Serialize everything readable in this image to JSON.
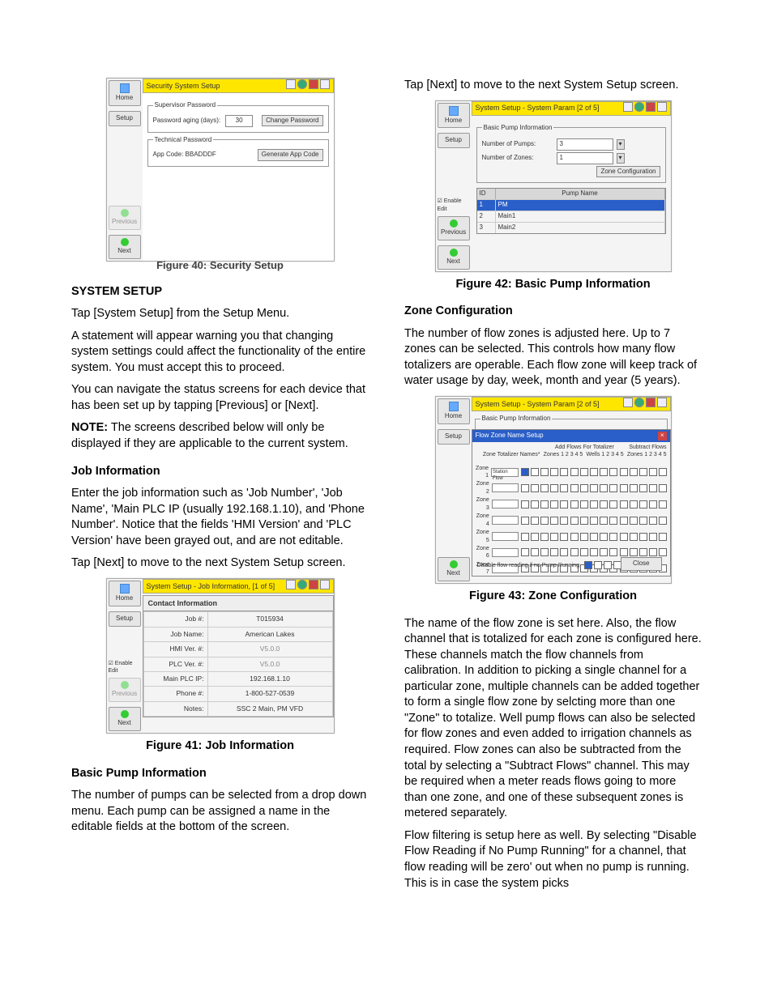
{
  "left": {
    "fig40": {
      "caption": "Figure 40: Security Setup",
      "title": "Security System Setup",
      "home": "Home",
      "setup": "Setup",
      "previous": "Previous",
      "next": "Next",
      "supLegend": "Supervisor Password",
      "pwAgingLabel": "Password aging (days):",
      "pwAgingVal": "30",
      "changePw": "Change Password",
      "techLegend": "Technical Password",
      "appCode": "App Code: BBADDDF",
      "genAppCode": "Generate App Code"
    },
    "h1": "SYSTEM SETUP",
    "p1": "Tap [System Setup] from the Setup Menu.",
    "p2": "A statement will appear warning you that changing system settings could affect the functionality of the entire system. You must accept this to proceed.",
    "p3": "You can navigate the status screens for each device that has been set up by tapping [Previous] or [Next].",
    "noteLabel": "NOTE:",
    "noteBody": " The screens described below will only be displayed if they are applicable to the current system.",
    "h2": "Job Information",
    "p4": "Enter the job information such as 'Job Number', 'Job Name', 'Main PLC IP (usually 192.168.1.10), and 'Phone Number'. Notice that the fields 'HMI Version' and 'PLC Version' have been grayed out, and are not editable.",
    "p5": "Tap [Next] to move to the next System Setup screen.",
    "fig41": {
      "caption": "Figure 41: Job Information",
      "title": "System Setup - Job Information, [1 of 5]",
      "ci": "Contact Information",
      "rows": [
        {
          "label": "Job #:",
          "value": "T015934"
        },
        {
          "label": "Job Name:",
          "value": "American Lakes"
        },
        {
          "label": "HMI Ver. #:",
          "value": "V5.0.0"
        },
        {
          "label": "PLC Ver. #:",
          "value": "V5.0.0"
        },
        {
          "label": "Main PLC IP:",
          "value": "192.168.1.10"
        },
        {
          "label": "Phone #:",
          "value": "1-800-527-0539"
        },
        {
          "label": "Notes:",
          "value": "SSC 2 Main, PM VFD"
        }
      ],
      "enableEdit": "Enable Edit",
      "home": "Home",
      "setup": "Setup",
      "previous": "Previous",
      "next": "Next"
    },
    "h3": "Basic Pump Information",
    "p6": "The number of pumps can be selected from a drop down menu. Each pump can be assigned a name in the editable fields at the bottom of the screen."
  },
  "right": {
    "p1": "Tap [Next] to move to the next System Setup screen.",
    "fig42": {
      "caption": "Figure 42: Basic Pump Information",
      "title": "System Setup - System Param [2 of 5]",
      "legend": "Basic Pump Information",
      "numPumpsL": "Number of Pumps:",
      "numPumpsV": "3",
      "numZonesL": "Number of Zones:",
      "numZonesV": "1",
      "zoneCfg": "Zone Configuration",
      "idH": "ID",
      "pnameH": "Pump Name",
      "pumps": [
        {
          "id": "1",
          "name": "PM"
        },
        {
          "id": "2",
          "name": "Main1"
        },
        {
          "id": "3",
          "name": "Main2"
        }
      ],
      "enableEdit": "Enable Edit",
      "home": "Home",
      "setup": "Setup",
      "previous": "Previous",
      "next": "Next"
    },
    "h1": "Zone Configuration",
    "p2": "The number of flow zones is adjusted here. Up to 7 zones can be selected.  This controls how many flow totalizers are operable.  Each flow zone will keep track of water usage by day, week, month and year (5 years).",
    "fig43": {
      "caption": "Figure 43: Zone Configuration",
      "title": "System Setup - System Param [2 of 5]",
      "legend": "Basic Pump Information",
      "modalTitle": "Flow Zone Name Setup",
      "ztn": "Zone Totalizer Names*",
      "addHdr": "Add Flows For Totalizer",
      "subHdr": "Subtract Flows",
      "zonesHdr": "Zones",
      "wellsHdr": "Wells",
      "zone1Name": "Station Flow",
      "zones": [
        "Zone 1",
        "Zone 2",
        "Zone 3",
        "Zone 4",
        "Zone 5",
        "Zone 6",
        "Zone 7"
      ],
      "disableLabel": "Disable flow reading if no Pump Running",
      "close": "Close",
      "home": "Home",
      "setup": "Setup",
      "next": "Next"
    },
    "p3": "The name of the flow zone is set here.  Also, the flow channel that is totalized for each zone is configured here.  These channels match the flow channels from calibration.  In addition to picking a single channel for a particular zone, multiple channels can be added together to form a single flow zone by selcting more than one \"Zone\" to totalize.  Well pump flows can also be selected for flow zones and even added to irrigation channels as required.  Flow zones can also be subtracted from the total by selecting a \"Subtract Flows\" channel. This may be required when a meter reads flows going to more than one zone, and one of these subsequent zones is metered separately.",
    "p4": "Flow filtering is setup here as well.  By selecting \"Disable Flow Reading if No Pump Running\" for a channel, that flow reading will be zero' out when no pump is running.  This is in case the system picks"
  }
}
